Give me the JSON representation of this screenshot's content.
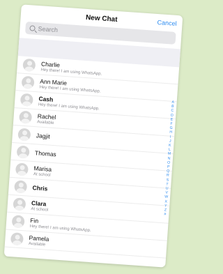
{
  "header": {
    "title": "New Chat",
    "cancel_label": "Cancel"
  },
  "search": {
    "placeholder": "Search"
  },
  "contacts": [
    {
      "name": "Charlie",
      "status": "Hey there! I am using WhatsApp.",
      "bold": false
    },
    {
      "name": "Ann Marie",
      "status": "Hey there! I am using WhatsApp.",
      "bold": false
    },
    {
      "name": "Cash",
      "status": "Hey there! I am using WhatsApp.",
      "bold": true
    },
    {
      "name": "Rachel",
      "status": "Available",
      "bold": false
    },
    {
      "name": "Jagjit",
      "status": "",
      "bold": false
    },
    {
      "name": "Thomas",
      "status": "",
      "bold": false
    },
    {
      "name": "Marisa",
      "status": "At school",
      "bold": false
    },
    {
      "name": "Chris",
      "status": "",
      "bold": true
    },
    {
      "name": "Clara",
      "status": "At school",
      "bold": true
    },
    {
      "name": "Fin",
      "status": "Hey there! I am using WhatsApp.",
      "bold": false
    },
    {
      "name": "Pamela",
      "status": "Available",
      "bold": false
    }
  ],
  "index_letters": [
    "A",
    "B",
    "C",
    "D",
    "E",
    "F",
    "G",
    "H",
    "I",
    "J",
    "K",
    "L",
    "M",
    "N",
    "O",
    "P",
    "Q",
    "R",
    "S",
    "T",
    "U",
    "V",
    "W",
    "X",
    "Y",
    "Z",
    "#"
  ],
  "colors": {
    "accent": "#2d8cf0",
    "background": "#dcebc7"
  },
  "icons": {
    "search": "search-icon",
    "avatar": "person-avatar-icon"
  }
}
